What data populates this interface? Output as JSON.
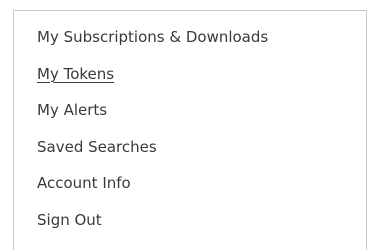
{
  "account_menu": {
    "items": [
      {
        "label": "My Subscriptions & Downloads",
        "active": false
      },
      {
        "label": "My Tokens",
        "active": true
      },
      {
        "label": "My Alerts",
        "active": false
      },
      {
        "label": "Saved Searches",
        "active": false
      },
      {
        "label": "Account Info",
        "active": false
      },
      {
        "label": "Sign Out",
        "active": false
      }
    ]
  }
}
